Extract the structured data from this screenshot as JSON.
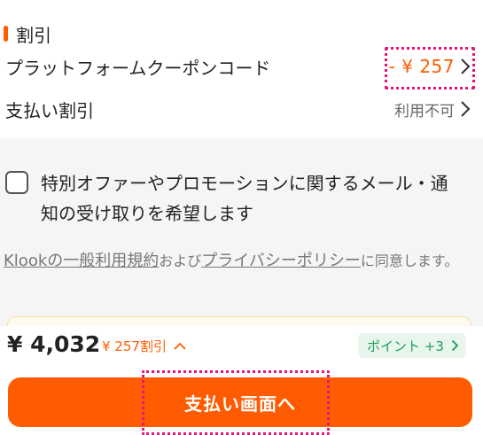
{
  "discount_section": {
    "title": "割引",
    "platform_coupon": {
      "label": "プラットフォームクーポンコード",
      "value": "- ¥ 257"
    },
    "payment_discount": {
      "label": "支払い割引",
      "value": "利用不可"
    }
  },
  "offer_opt_in": {
    "line1": "特別オファーやプロモーションに関するメール・通",
    "line2": "知の受け取りを希望します",
    "checked": false
  },
  "terms": {
    "terms_link": "Klookの一般利用規約",
    "and_text": "および",
    "privacy_link": "プライバシーポリシー",
    "suffix": "に同意します。"
  },
  "footer": {
    "total": "¥ 4,032",
    "discount_text": "¥ 257割引",
    "points": "ポイント +3",
    "pay_button": "支払い画面へ"
  },
  "colors": {
    "accent": "#ff5b00",
    "points_green": "#1d9e56",
    "highlight": "#e5157a"
  }
}
